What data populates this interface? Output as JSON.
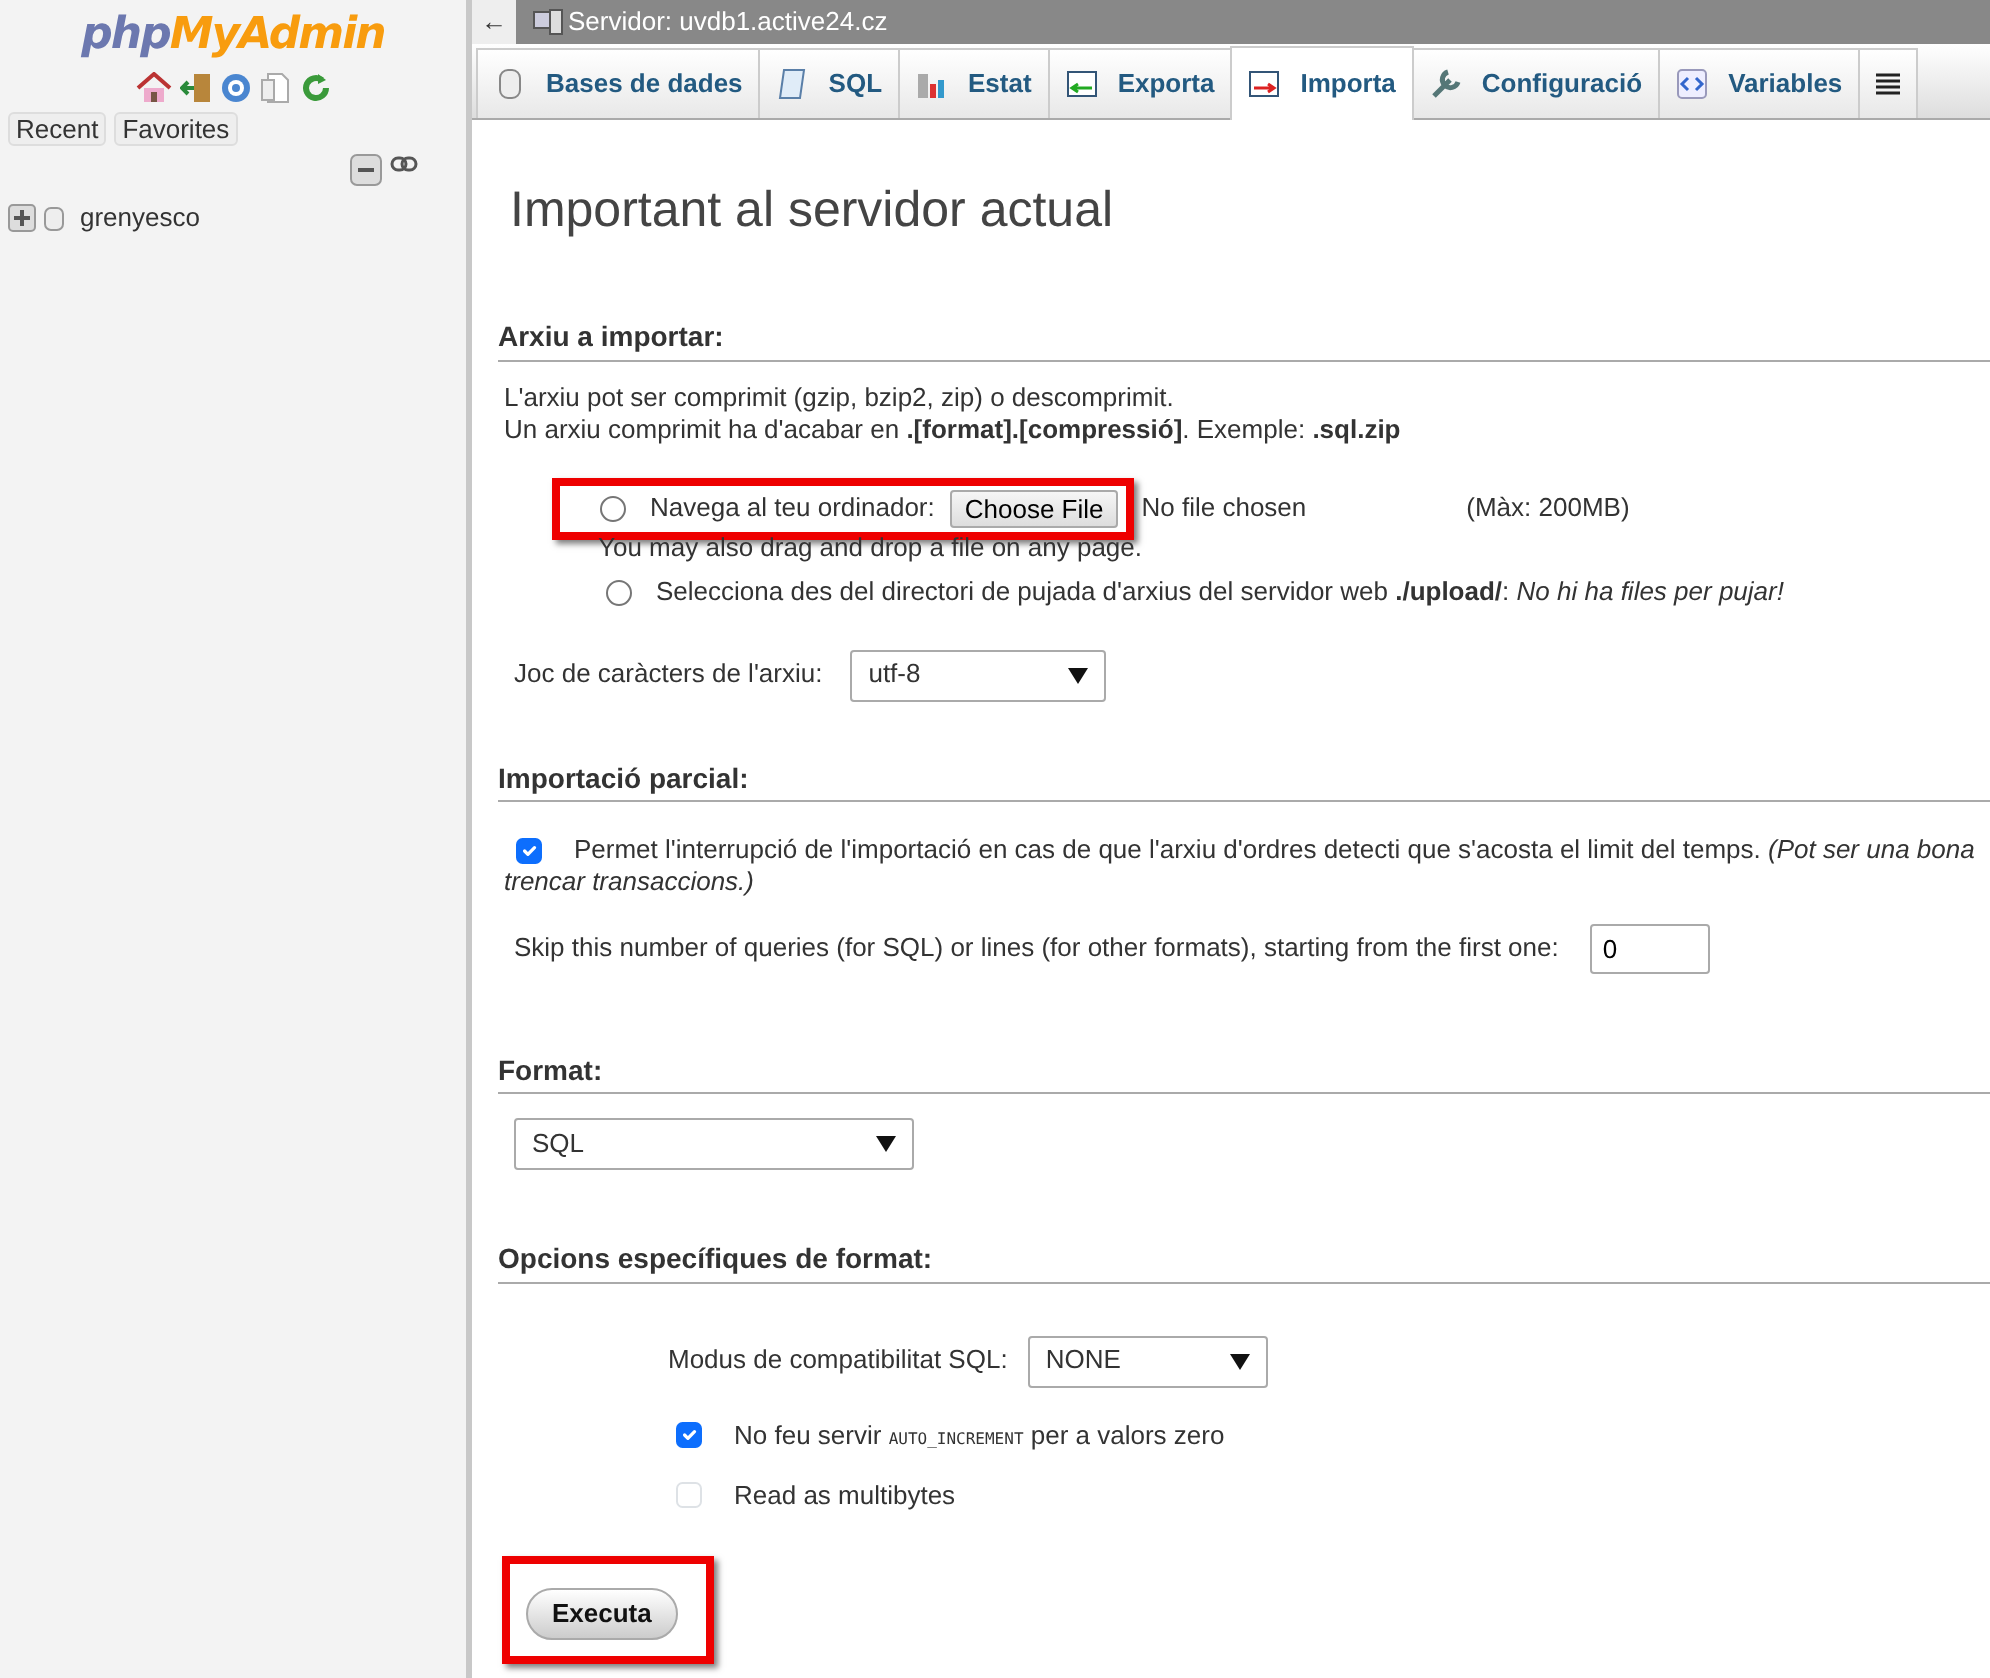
{
  "sidebar": {
    "logo": [
      "php",
      "MyAdmin"
    ],
    "buttons": [
      "Recent",
      "Favorites"
    ],
    "tree": [
      {
        "label": "grenyesco",
        "expanded": false
      }
    ]
  },
  "topbar": {
    "back": "←",
    "title": "Servidor: uvdb1.active24.cz"
  },
  "tabs": [
    {
      "label": "Bases de dades",
      "selected": false
    },
    {
      "label": "SQL",
      "selected": false
    },
    {
      "label": "Estat",
      "selected": false
    },
    {
      "label": "Exporta",
      "selected": false
    },
    {
      "label": "Importa",
      "selected": true
    },
    {
      "label": "Configuració",
      "selected": false
    },
    {
      "label": "Variables",
      "selected": false
    }
  ],
  "page_title": "Important al servidor actual",
  "file_section": {
    "heading": "Arxiu a importar:",
    "notes": [
      "L'arxiu pot ser comprimit (gzip, bzip2, zip) o descomprimit.",
      "Un arxiu comprimit ha d'acabar en **.[format].[compressió]**. Exemple: **.sql.zip**"
    ],
    "browse": {
      "label": "Navega al teu ordinador:",
      "selected": false,
      "highlighted": true,
      "button": "Choose File",
      "status": "No file chosen",
      "max": "(Màx: 200MB)",
      "hint": "You may also drag and drop a file on any page."
    },
    "upload_dir": {
      "label": "Selecciona des del directori de pujada d'arxius del servidor web **./upload/**: *No hi ha files per pujar!*",
      "selected": false
    },
    "charset": {
      "label": "Joc de caràcters de l'arxiu:",
      "value": "utf-8"
    }
  },
  "partial_section": {
    "heading": "Importació parcial:",
    "allow_interrupt": {
      "label": "Permet l'interrupció de l'importació en cas de que l'arxiu d'ordres detecti que s'acosta el limit del temps. *(Pot ser una bona*",
      "continuation": "trencar transaccions.)",
      "checked": true
    },
    "skip": {
      "label": "Skip this number of queries (for SQL) or lines (for other formats), starting from the first one:",
      "value": "0"
    }
  },
  "format_section": {
    "heading": "Format:",
    "value": "SQL"
  },
  "options_section": {
    "heading": "Opcions específiques de format:",
    "compat": {
      "label": "Modus de compatibilitat SQL:",
      "value": "NONE"
    },
    "checkboxes": [
      {
        "before": "No feu servir",
        "code": "AUTO_INCREMENT",
        "after": "per a valors zero",
        "checked": true
      },
      {
        "before": "Read as multibytes",
        "checked": false
      }
    ]
  },
  "submit": {
    "label": "Executa",
    "highlighted": true
  }
}
